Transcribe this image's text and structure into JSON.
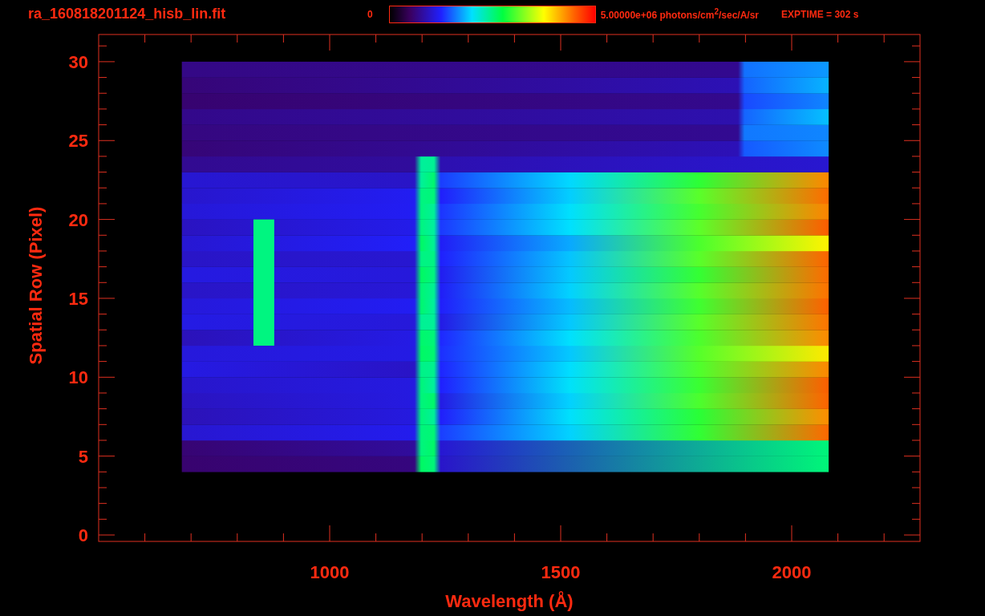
{
  "title": "ra_160818201124_hisb_lin.fit",
  "colorbar": {
    "min_label": "0",
    "max_label": "5.00000e+06 photons/cm$^{2}$/sec/A/sr"
  },
  "exposure": "EXPTIME = 302 s",
  "plot": {
    "xlabel": "Wavelength (Å)",
    "ylabel": "Spatial Row (Pixel)",
    "xticks": [
      "1000",
      "1500",
      "2000"
    ],
    "yticks": [
      "30",
      "25",
      "20",
      "15",
      "10",
      "5",
      "0"
    ]
  }
}
